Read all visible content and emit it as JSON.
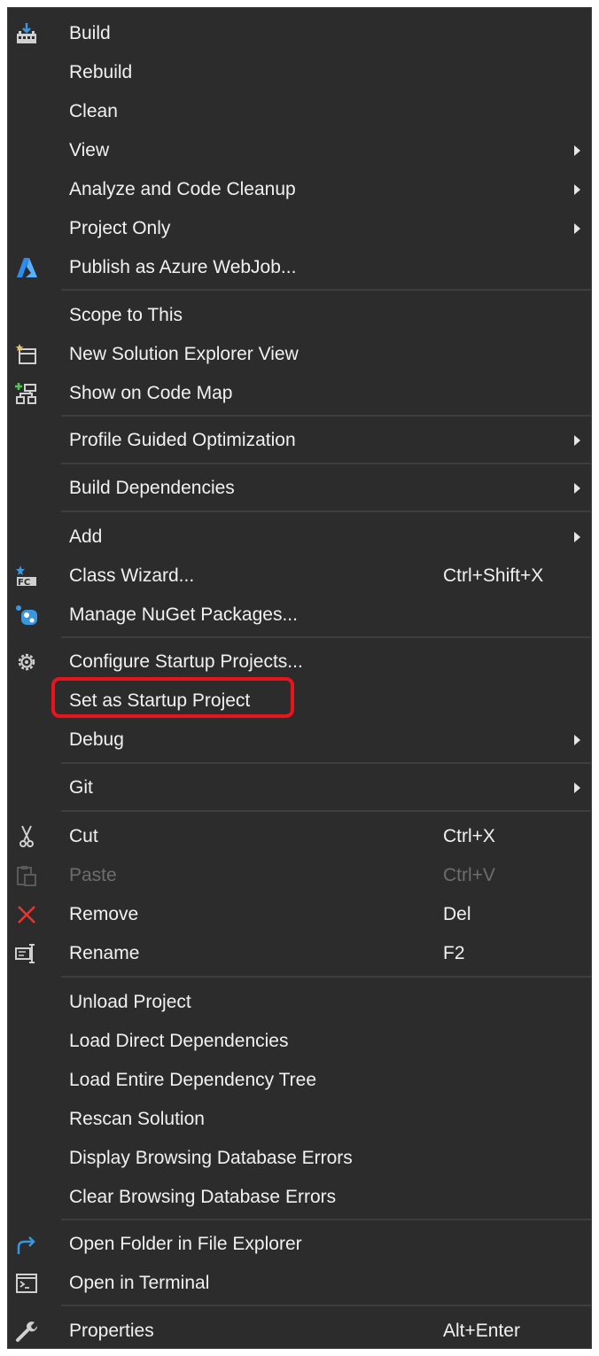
{
  "colors": {
    "menu_bg": "#2c2c2c",
    "text": "#f1f1f1",
    "disabled_text": "#6d6d6d",
    "separator": "#3e3e3e",
    "highlight": "#e8141c",
    "azure_blue": "#2d8cf0",
    "remove_red": "#e8362f"
  },
  "menu": {
    "build": {
      "label": "Build",
      "icon": "build-icon"
    },
    "rebuild": {
      "label": "Rebuild"
    },
    "clean": {
      "label": "Clean"
    },
    "view": {
      "label": "View"
    },
    "analyze": {
      "label": "Analyze and Code Cleanup"
    },
    "project_only": {
      "label": "Project Only"
    },
    "publish": {
      "label": "Publish as Azure WebJob...",
      "icon": "azure-icon"
    },
    "scope": {
      "label": "Scope to This"
    },
    "new_view": {
      "label": "New Solution Explorer View",
      "icon": "new-view-icon"
    },
    "code_map": {
      "label": "Show on Code Map",
      "icon": "code-map-icon"
    },
    "pgo": {
      "label": "Profile Guided Optimization"
    },
    "build_deps": {
      "label": "Build Dependencies"
    },
    "add": {
      "label": "Add"
    },
    "class_wizard": {
      "label": "Class Wizard...",
      "shortcut": "Ctrl+Shift+X",
      "icon": "class-wizard-icon"
    },
    "nuget": {
      "label": "Manage NuGet Packages...",
      "icon": "nuget-icon"
    },
    "configure_startup": {
      "label": "Configure Startup Projects...",
      "icon": "gear-icon"
    },
    "set_startup": {
      "label": "Set as Startup Project",
      "highlighted": true
    },
    "debug": {
      "label": "Debug"
    },
    "git": {
      "label": "Git"
    },
    "cut": {
      "label": "Cut",
      "shortcut": "Ctrl+X",
      "icon": "scissors-icon"
    },
    "paste": {
      "label": "Paste",
      "shortcut": "Ctrl+V",
      "icon": "clipboard-icon",
      "disabled": true
    },
    "remove": {
      "label": "Remove",
      "shortcut": "Del",
      "icon": "remove-icon"
    },
    "rename": {
      "label": "Rename",
      "shortcut": "F2",
      "icon": "rename-icon"
    },
    "unload": {
      "label": "Unload Project"
    },
    "load_direct": {
      "label": "Load Direct Dependencies"
    },
    "load_entire": {
      "label": "Load Entire Dependency Tree"
    },
    "rescan": {
      "label": "Rescan Solution"
    },
    "display_errors": {
      "label": "Display Browsing Database Errors"
    },
    "clear_errors": {
      "label": "Clear Browsing Database Errors"
    },
    "open_folder": {
      "label": "Open Folder in File Explorer",
      "icon": "open-folder-icon"
    },
    "open_terminal": {
      "label": "Open in Terminal",
      "icon": "terminal-icon"
    },
    "properties": {
      "label": "Properties",
      "shortcut": "Alt+Enter",
      "icon": "wrench-icon"
    }
  }
}
